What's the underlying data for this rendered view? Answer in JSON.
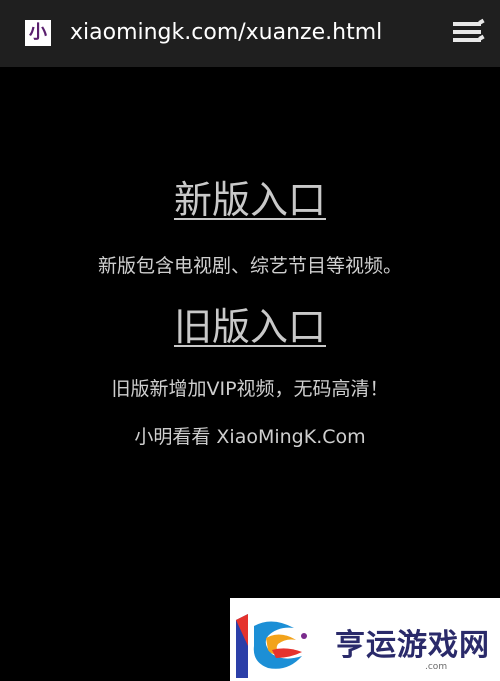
{
  "browser": {
    "favicon_text": "小",
    "url": "xiaomingk.com/xuanze.html",
    "menu_icon": "hamburger-menu-icon"
  },
  "main": {
    "new_entry": {
      "label": "新版入口",
      "description": "新版包含电视剧、综艺节目等视频。"
    },
    "old_entry": {
      "label": "旧版入口",
      "description": "旧版新增加VIP视频，无码高清！"
    },
    "site_name": "小明看看 XiaoMingK.Com"
  },
  "watermark": {
    "brand_text": "亨运游戏网",
    "domain": ".com"
  },
  "colors": {
    "topbar": "#1f1f1f",
    "background": "#000000",
    "link": "#c9c9c9",
    "text": "#cfcfcf"
  }
}
